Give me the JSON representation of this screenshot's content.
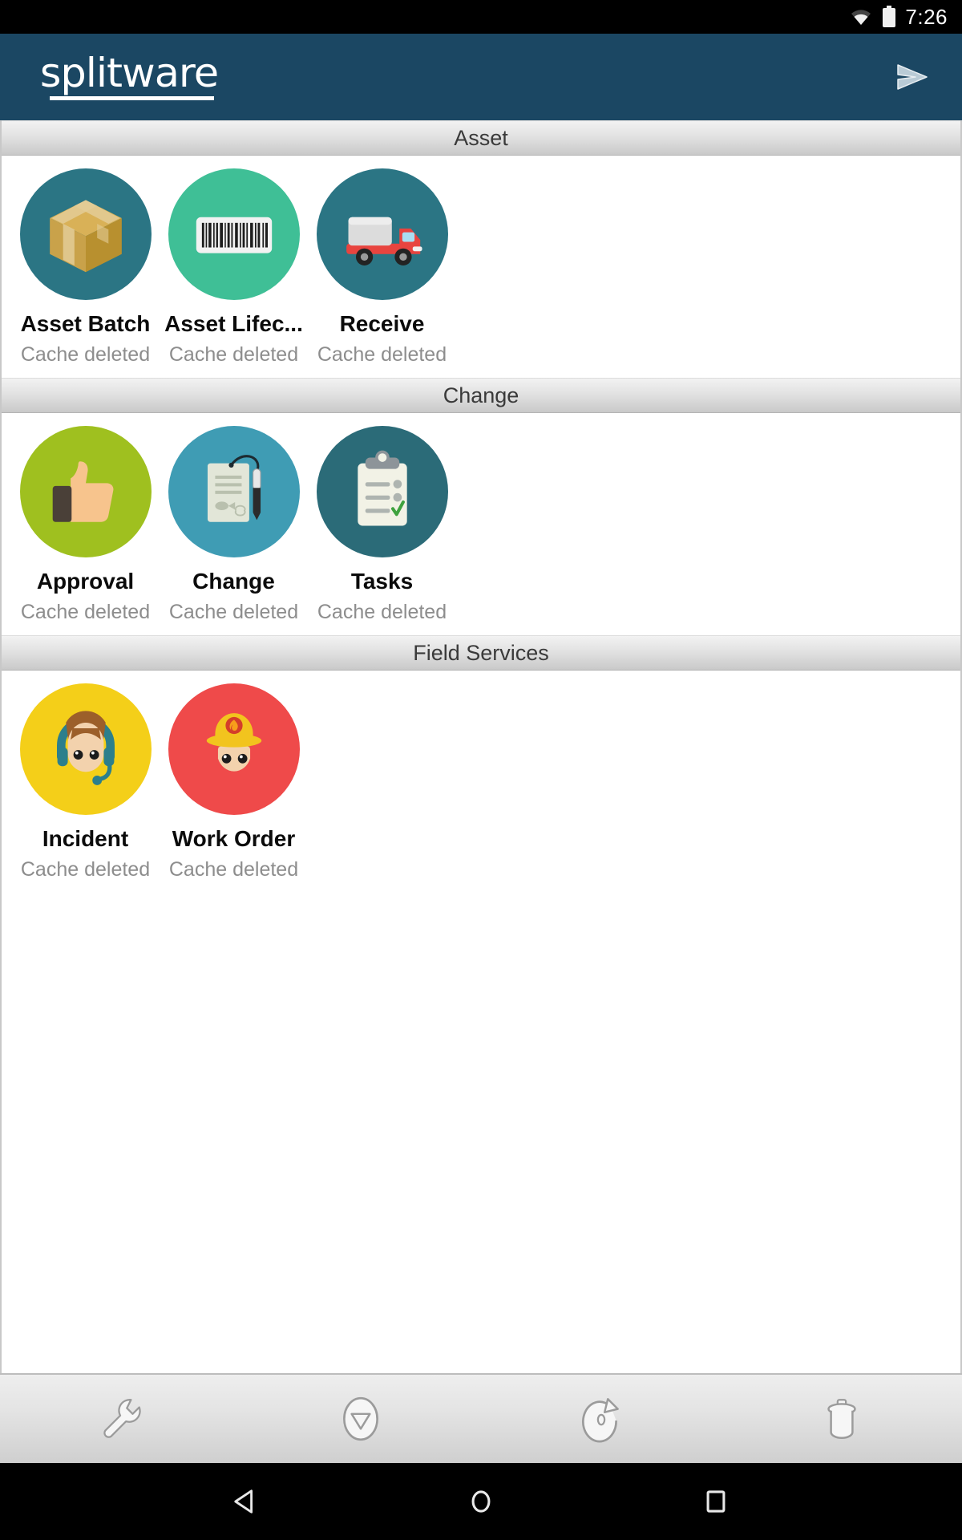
{
  "status_bar": {
    "time": "7:26",
    "wifi_icon": "wifi-icon",
    "battery_icon": "battery-icon"
  },
  "app_bar": {
    "logo_text": "splitware",
    "send_icon": "send-icon",
    "background_color": "#1b4763"
  },
  "sections": [
    {
      "title": "Asset",
      "tiles": [
        {
          "label": "Asset Batch",
          "subtitle": "Cache deleted",
          "icon": "package-box-icon",
          "color": "#2b7584"
        },
        {
          "label": "Asset Lifec...",
          "subtitle": "Cache deleted",
          "icon": "barcode-icon",
          "color": "#3fbf96"
        },
        {
          "label": "Receive",
          "subtitle": "Cache deleted",
          "icon": "delivery-truck-icon",
          "color": "#2b7584"
        }
      ]
    },
    {
      "title": "Change",
      "tiles": [
        {
          "label": "Approval",
          "subtitle": "Cache deleted",
          "icon": "thumbs-up-icon",
          "color": "#9fc01f"
        },
        {
          "label": "Change",
          "subtitle": "Cache deleted",
          "icon": "document-pen-icon",
          "color": "#3f9cb4"
        },
        {
          "label": "Tasks",
          "subtitle": "Cache deleted",
          "icon": "clipboard-check-icon",
          "color": "#2b6b78"
        }
      ]
    },
    {
      "title": "Field Services",
      "tiles": [
        {
          "label": "Incident",
          "subtitle": "Cache deleted",
          "icon": "support-agent-icon",
          "color": "#f4cf19"
        },
        {
          "label": "Work Order",
          "subtitle": "Cache deleted",
          "icon": "firefighter-icon",
          "color": "#ef4a4a"
        }
      ]
    }
  ],
  "toolbar": [
    {
      "name": "settings-wrench-button",
      "icon": "wrench-icon"
    },
    {
      "name": "download-button",
      "icon": "circle-chevron-down-icon"
    },
    {
      "name": "refresh-button",
      "icon": "circular-refresh-icon"
    },
    {
      "name": "delete-cache-button",
      "icon": "trash-icon"
    }
  ],
  "nav_bar": [
    {
      "name": "nav-back-button",
      "icon": "triangle-back-icon"
    },
    {
      "name": "nav-home-button",
      "icon": "circle-home-icon"
    },
    {
      "name": "nav-recents-button",
      "icon": "square-recents-icon"
    }
  ]
}
